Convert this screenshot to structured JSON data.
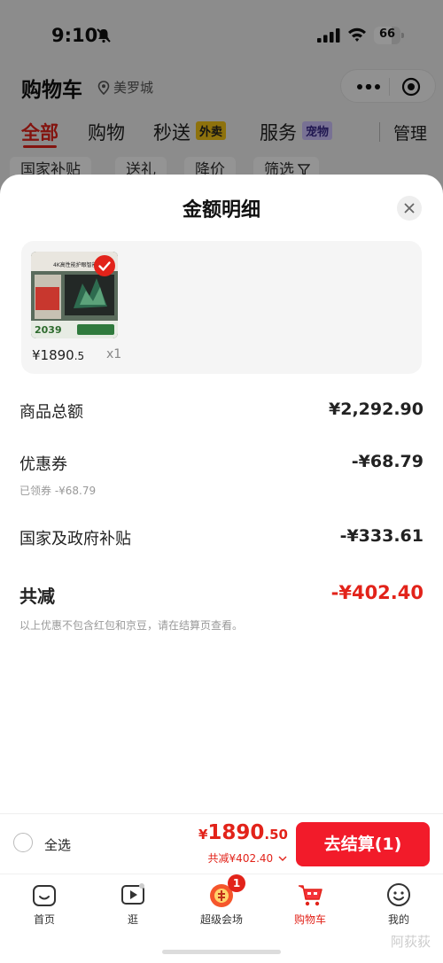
{
  "status_bar": {
    "time": "9:10",
    "battery": "66",
    "battery_level": 0.66,
    "icons": [
      "bell-off-icon",
      "signal-icon",
      "wifi-icon",
      "battery-icon"
    ]
  },
  "header": {
    "title": "购物车",
    "location": "美罗城",
    "location_icon": "location-pin-icon",
    "capsule_icons": [
      "more-dots-icon",
      "target-icon"
    ]
  },
  "tabs": [
    {
      "label": "全部",
      "active": true
    },
    {
      "label": "购物",
      "active": false
    },
    {
      "label": "秒送",
      "badge": "外卖",
      "badge_color": "#f5c518",
      "active": false
    },
    {
      "label": "服务",
      "badge": "宠物",
      "badge_color": "#b9a6ff",
      "active": false
    }
  ],
  "manage_label": "管理",
  "filter_chips": [
    "国家补贴",
    "送礼",
    "降价",
    "筛选"
  ],
  "sheet": {
    "title": "金额明细",
    "close_icon": "close-icon",
    "product": {
      "price_int": "¥1890",
      "price_dec": ".5",
      "quantity": "x1",
      "thumb_text": {
        "top": "4K高性能护眼智能",
        "price_badge": "2039"
      }
    },
    "rows": [
      {
        "label": "商品总额",
        "value": "¥2,292.90"
      },
      {
        "label": "优惠券",
        "value": "-¥68.79",
        "sub": "已领券 -¥68.79"
      },
      {
        "label": "国家及政府补贴",
        "value": "-¥333.61"
      },
      {
        "label": "共减",
        "value": "-¥402.40",
        "total": true
      }
    ],
    "note": "以上优惠不包含红包和京豆，请在结算页查看。"
  },
  "checkout": {
    "select_all": "全选",
    "currency": "¥",
    "price_int": "1890",
    "price_dec": ".50",
    "discount_text": "共减¥402.40",
    "button": "去结算(1)"
  },
  "tabbar": [
    {
      "label": "首页",
      "icon": "home-icon"
    },
    {
      "label": "逛",
      "icon": "video-play-icon"
    },
    {
      "label": "超级会场",
      "icon": "super-venue-icon",
      "badge": "1"
    },
    {
      "label": "购物车",
      "icon": "cart-icon",
      "active": true
    },
    {
      "label": "我的",
      "icon": "profile-face-icon"
    }
  ],
  "watermark": "阿荻荻",
  "colors": {
    "accent": "#e2231a",
    "button": "#f21b2a",
    "card_bg": "#f5f5f5"
  }
}
